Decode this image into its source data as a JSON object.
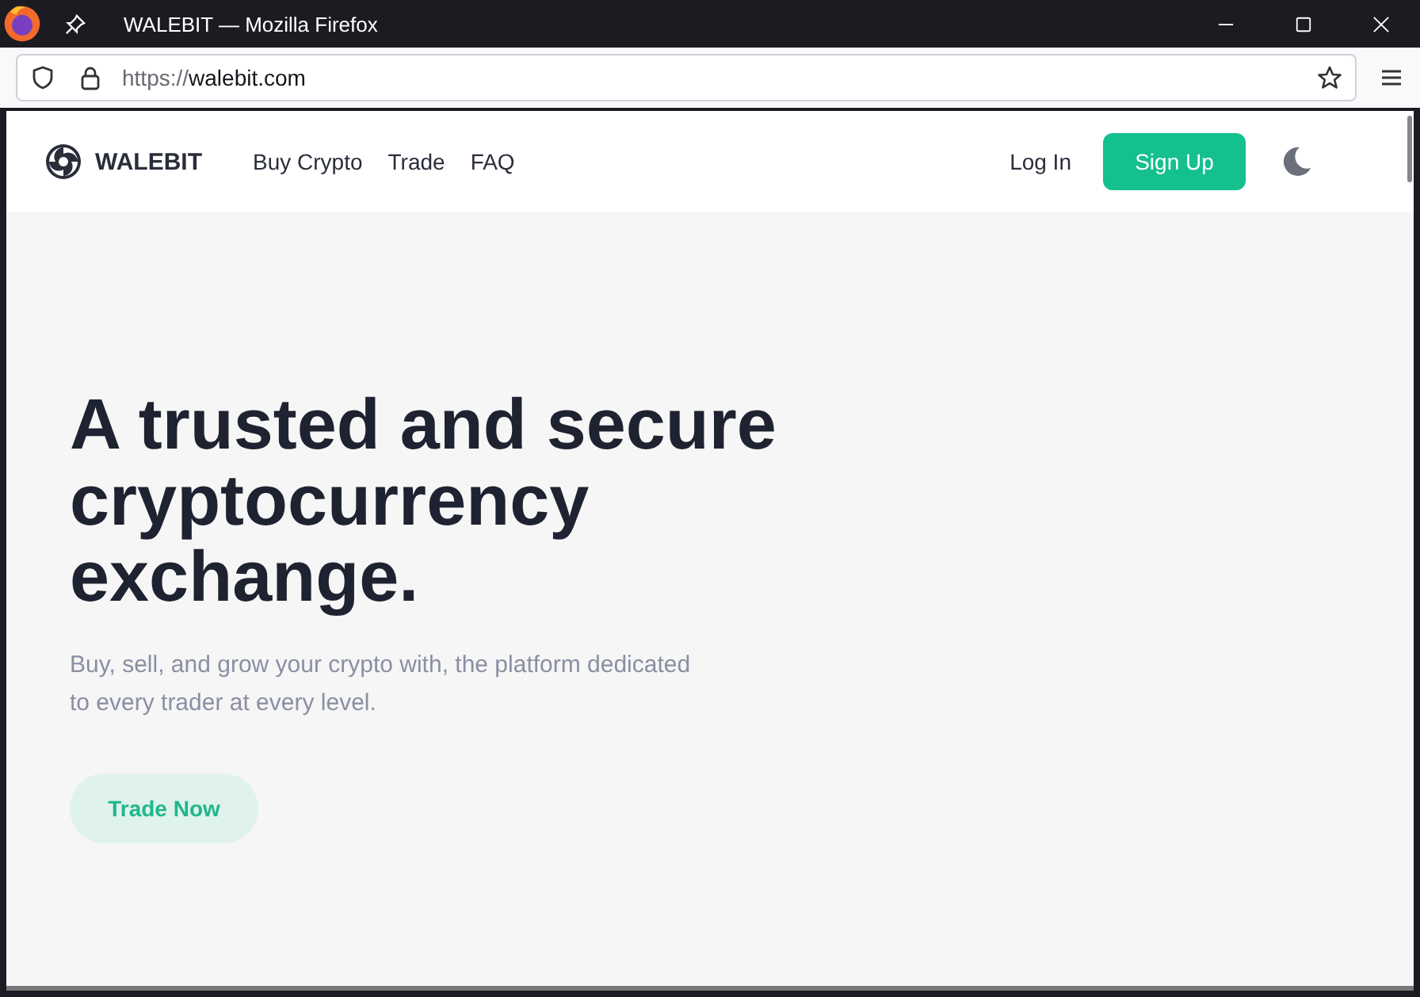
{
  "window": {
    "title": "WALEBIT — Mozilla Firefox"
  },
  "address_bar": {
    "scheme": "https://",
    "host": "walebit.com"
  },
  "header": {
    "brand": "WALEBIT",
    "nav": [
      {
        "label": "Buy Crypto"
      },
      {
        "label": "Trade"
      },
      {
        "label": "FAQ"
      }
    ],
    "login": "Log In",
    "signup": "Sign Up"
  },
  "hero": {
    "headline": [
      "A trusted and secure",
      "cryptocurrency",
      "exchange."
    ],
    "subtitle": [
      "Buy, sell, and grow your crypto with, the platform dedicated",
      "to every trader at every level."
    ],
    "cta": "Trade Now"
  }
}
